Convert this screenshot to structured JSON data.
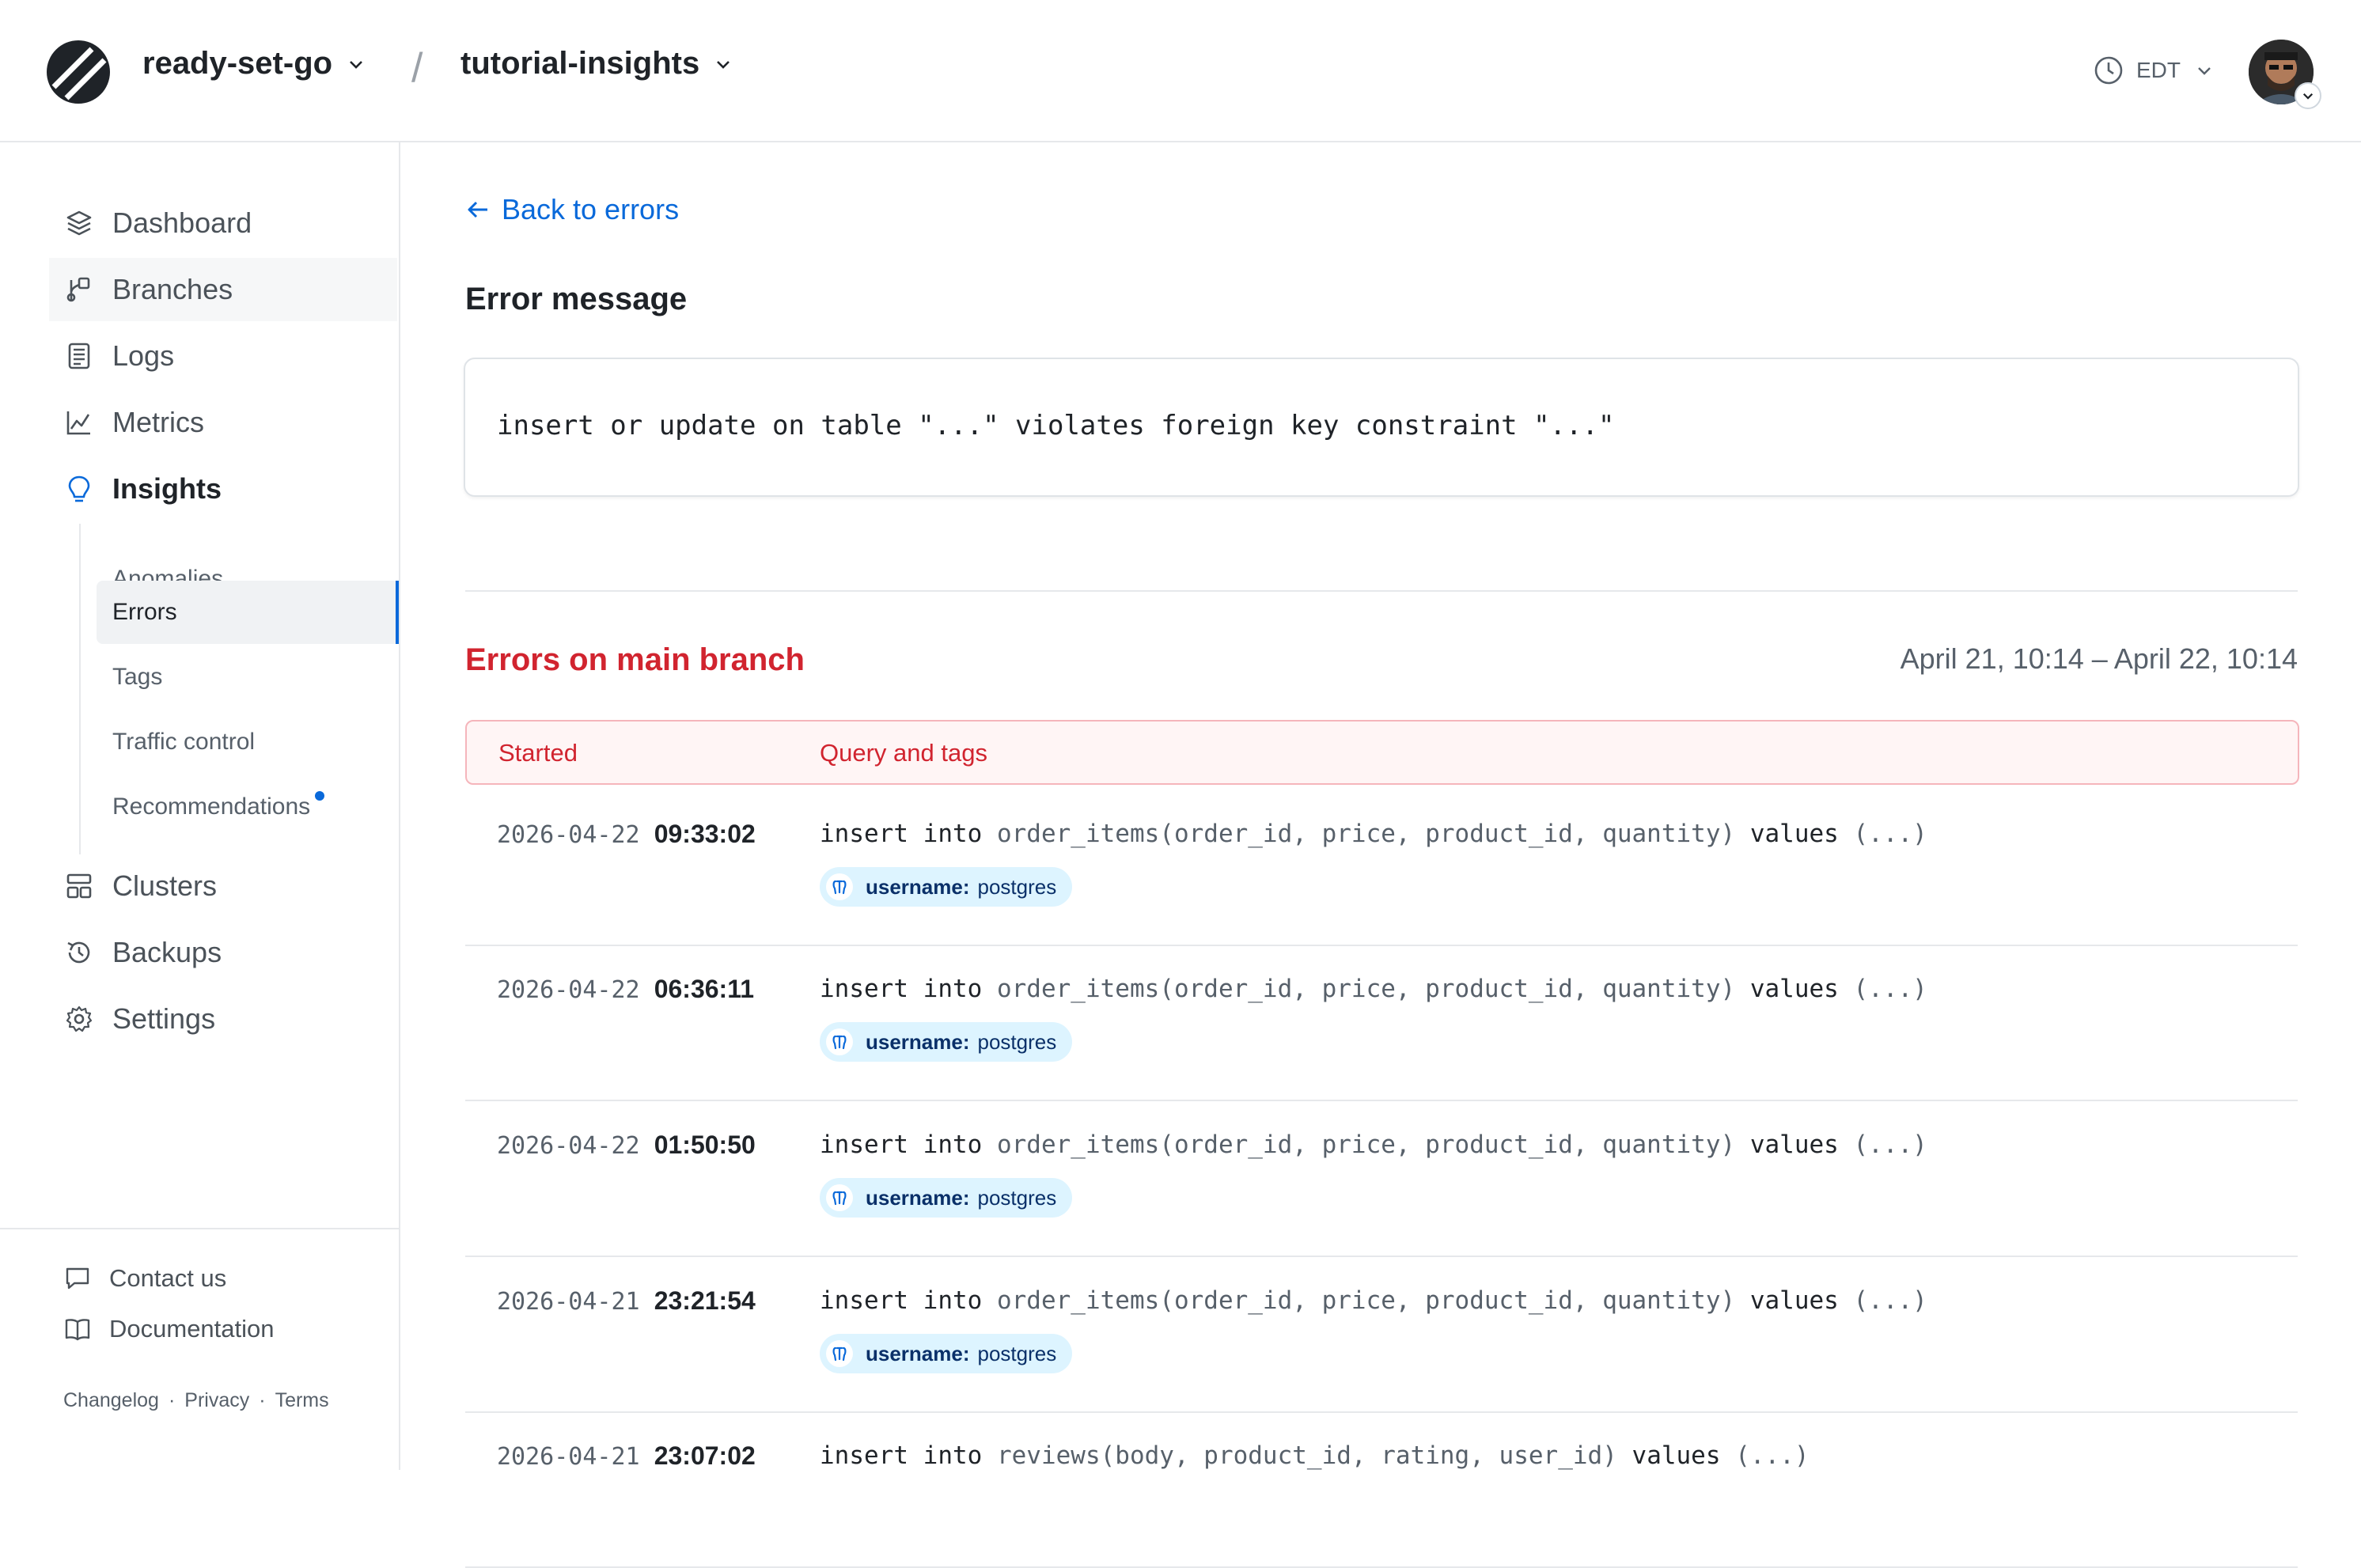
{
  "header": {
    "org": "ready-set-go",
    "separator": "/",
    "database": "tutorial-insights",
    "timezone": "EDT"
  },
  "sidebar": {
    "items": [
      {
        "label": "Dashboard",
        "icon": "layers-icon"
      },
      {
        "label": "Branches",
        "icon": "branch-icon"
      },
      {
        "label": "Logs",
        "icon": "logs-icon"
      },
      {
        "label": "Metrics",
        "icon": "chart-icon"
      },
      {
        "label": "Insights",
        "icon": "lightbulb-icon"
      },
      {
        "label": "Clusters",
        "icon": "clusters-icon"
      },
      {
        "label": "Backups",
        "icon": "history-icon"
      },
      {
        "label": "Settings",
        "icon": "gear-icon"
      }
    ],
    "insights_sub": [
      "Anomalies",
      "Errors",
      "Tags",
      "Traffic control",
      "Recommendations"
    ],
    "footer": {
      "contact": "Contact us",
      "docs": "Documentation",
      "changelog": "Changelog",
      "privacy": "Privacy",
      "terms": "Terms",
      "dot": "·"
    }
  },
  "main": {
    "back_label": "Back to errors",
    "error_message_heading": "Error message",
    "error_message": "insert or update on table \"...\" violates foreign key constraint \"...\"",
    "errors_heading": "Errors on main branch",
    "range": "April 21, 10:14 – April 22, 10:14",
    "columns": [
      "Started",
      "Query and tags"
    ],
    "rows": [
      {
        "date": "2026-04-22",
        "time": "09:33:02",
        "q_insert": "insert",
        "q_into": "into",
        "q_target": "order_items(order_id, price, product_id, quantity)",
        "q_values": "values",
        "q_rest": "(...)",
        "tag_key": "username:",
        "tag_value": "postgres"
      },
      {
        "date": "2026-04-22",
        "time": "06:36:11",
        "q_insert": "insert",
        "q_into": "into",
        "q_target": "order_items(order_id, price, product_id, quantity)",
        "q_values": "values",
        "q_rest": "(...)",
        "tag_key": "username:",
        "tag_value": "postgres"
      },
      {
        "date": "2026-04-22",
        "time": "01:50:50",
        "q_insert": "insert",
        "q_into": "into",
        "q_target": "order_items(order_id, price, product_id, quantity)",
        "q_values": "values",
        "q_rest": "(...)",
        "tag_key": "username:",
        "tag_value": "postgres"
      },
      {
        "date": "2026-04-21",
        "time": "23:21:54",
        "q_insert": "insert",
        "q_into": "into",
        "q_target": "order_items(order_id, price, product_id, quantity)",
        "q_values": "values",
        "q_rest": "(...)",
        "tag_key": "username:",
        "tag_value": "postgres"
      },
      {
        "date": "2026-04-21",
        "time": "23:07:02",
        "q_insert": "insert",
        "q_into": "into",
        "q_target": "reviews(body, product_id, rating, user_id)",
        "q_values": "values",
        "q_rest": "(...)"
      }
    ]
  },
  "colors": {
    "accent": "#0969da",
    "error": "#d1242f",
    "tag_bg": "#ddf4ff"
  }
}
